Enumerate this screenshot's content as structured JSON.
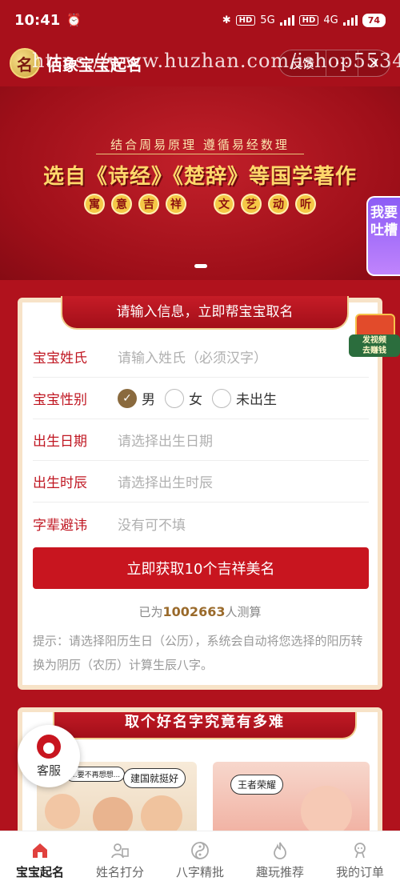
{
  "status_bar": {
    "time": "10:41",
    "hd_tag_1": "HD",
    "net_1": "5G",
    "hd_tag_2": "HD",
    "net_2": "4G",
    "battery": "74"
  },
  "title_bar": {
    "logo_char": "名",
    "app_title": "佰象宝宝起名",
    "watermark": "https://www.huzhan.com/ishop5534",
    "feedback_label": "反馈",
    "more_symbol": "···",
    "close_symbol": "✕"
  },
  "banner": {
    "subtitle": "结合周易原理 遵循易经数理",
    "headline": "选自《诗经》《楚辞》等国学著作",
    "pills_1": [
      "寓",
      "意",
      "吉",
      "祥"
    ],
    "pills_2": [
      "文",
      "艺",
      "动",
      "听"
    ]
  },
  "side_tab": {
    "label": "我要吐槽"
  },
  "video_badge": {
    "label_line1": "发视频",
    "label_line2": "去赚钱"
  },
  "form": {
    "header": "请输入信息，立即帮宝宝取名",
    "surname_label": "宝宝姓氏",
    "surname_placeholder": "请输入姓氏（必须汉字）",
    "gender_label": "宝宝性别",
    "gender_options": [
      "男",
      "女",
      "未出生"
    ],
    "gender_selected": "男",
    "birth_date_label": "出生日期",
    "birth_date_placeholder": "请选择出生日期",
    "birth_hour_label": "出生时辰",
    "birth_hour_placeholder": "请选择出生时辰",
    "taboo_label": "字辈避讳",
    "taboo_placeholder": "没有可不填",
    "submit_label": "立即获取10个吉祥美名",
    "count_prefix": "已为",
    "count_value": "1002663",
    "count_suffix": "人测算",
    "tip": "提示：请选择阳历生日（公历），系统会自动将您选择的阳历转换为阴历（农历）计算生辰八字。"
  },
  "card2": {
    "header": "取个好名字究竟有多难",
    "bubble_small": "...要不再想想...",
    "bubble_left": "建国就挺好",
    "bubble_right": "王者荣耀"
  },
  "service": {
    "label": "客服"
  },
  "tab_bar": {
    "items": [
      {
        "label": "宝宝起名",
        "icon": "home-icon"
      },
      {
        "label": "姓名打分",
        "icon": "score-icon"
      },
      {
        "label": "八字精批",
        "icon": "yinyang-icon"
      },
      {
        "label": "趣玩推荐",
        "icon": "fire-icon"
      },
      {
        "label": "我的订单",
        "icon": "user-icon"
      }
    ],
    "active_index": 0
  },
  "colors": {
    "primary_red": "#c8151f",
    "gold": "#ffd86b",
    "selected_radio": "#8a6a3e"
  }
}
